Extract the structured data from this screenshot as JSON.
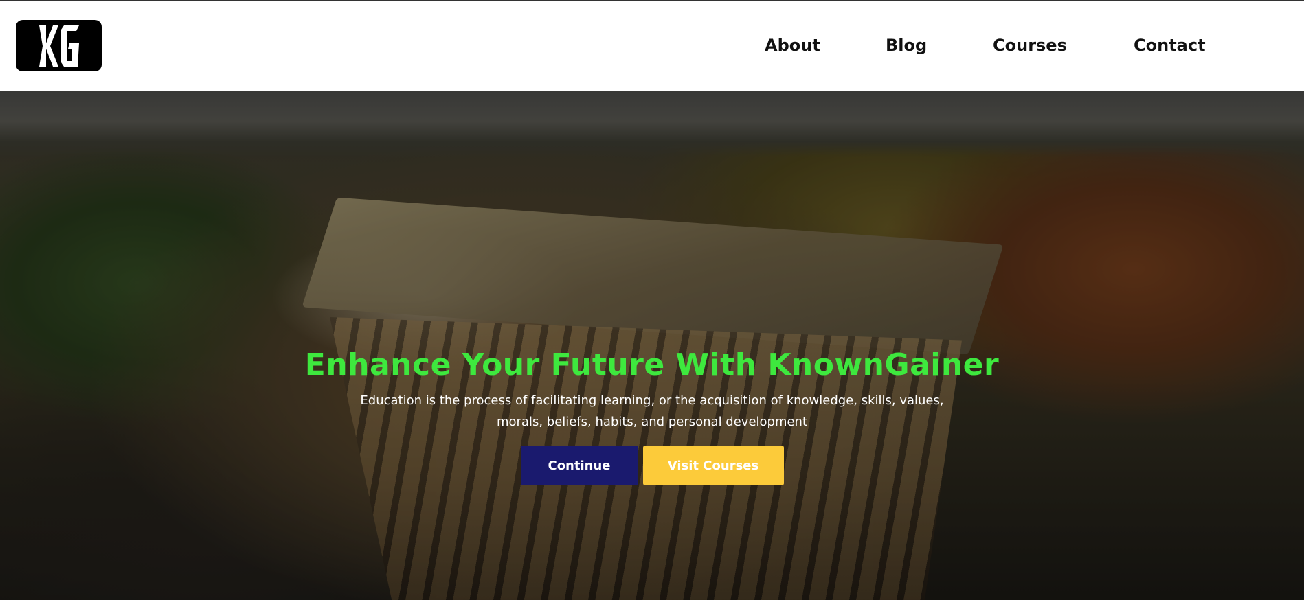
{
  "logo": {
    "text": "KG",
    "icon": "kg-logo"
  },
  "nav": {
    "items": [
      {
        "label": "About"
      },
      {
        "label": "Blog"
      },
      {
        "label": "Courses"
      },
      {
        "label": "Contact"
      }
    ]
  },
  "hero": {
    "title": "Enhance Your Future With KnownGainer",
    "subtitle": "Education is the process of facilitating learning, or the acquisition of knowledge, skills, values, morals, beliefs, habits, and personal development",
    "background": "aerial-campus-building-autumn-trees",
    "buttons": {
      "continue_label": "Continue",
      "visit_courses_label": "Visit Courses"
    }
  },
  "colors": {
    "title_green": "#3ee83e",
    "continue_bg": "#1a1a6e",
    "visit_bg": "#fccb3a",
    "nav_text": "#111111",
    "logo_bg": "#000000"
  }
}
